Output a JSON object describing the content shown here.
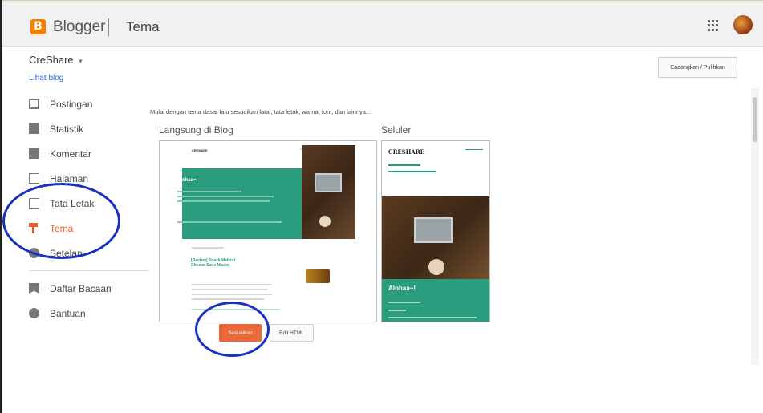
{
  "header": {
    "app_name": "Blogger",
    "logo_letter": "B",
    "page_title": "Tema",
    "apps_icon": "apps-grid-icon",
    "avatar_icon": "user-avatar"
  },
  "sidebar": {
    "blog_title": "CreShare",
    "blog_dropdown_icon": "▾",
    "view_blog_link": "Lihat blog",
    "items": [
      {
        "label": "Postingan",
        "icon": "posts-icon"
      },
      {
        "label": "Statistik",
        "icon": "stats-icon"
      },
      {
        "label": "Komentar",
        "icon": "comments-icon"
      },
      {
        "label": "Halaman",
        "icon": "pages-icon"
      },
      {
        "label": "Tata Letak",
        "icon": "layout-icon"
      },
      {
        "label": "Tema",
        "icon": "theme-icon",
        "active": true
      },
      {
        "label": "Setelan",
        "icon": "settings-icon"
      }
    ],
    "secondary_items": [
      {
        "label": "Daftar Bacaan",
        "icon": "reading-list-icon"
      },
      {
        "label": "Bantuan",
        "icon": "help-icon"
      }
    ]
  },
  "main": {
    "backup_restore_label": "Cadangkan / Pulihkan",
    "intro_text": "Mulai dengan tema dasar lalu sesuaikan latar, tata letak, warna, font, dan lainnya...",
    "live_section_title": "Langsung di Blog",
    "mobile_section_title": "Seluler",
    "desktop_preview": {
      "blog_name": "CREHARE",
      "hero_title": "Alohaa~!",
      "post_title": "[Review] Snack Malkist Cheese Saus Nissin"
    },
    "mobile_preview": {
      "blog_name": "CRESHARE",
      "hero_title": "Alohaa~!"
    },
    "customize_label": "Sesuaikan",
    "edit_html_label": "Edit HTML"
  },
  "colors": {
    "accent": "#e9693a",
    "active_nav": "#e45b2a",
    "theme_green": "#2a9d7e",
    "link_blue": "#3367d6",
    "annotation_circle": "#1b2fc0"
  }
}
